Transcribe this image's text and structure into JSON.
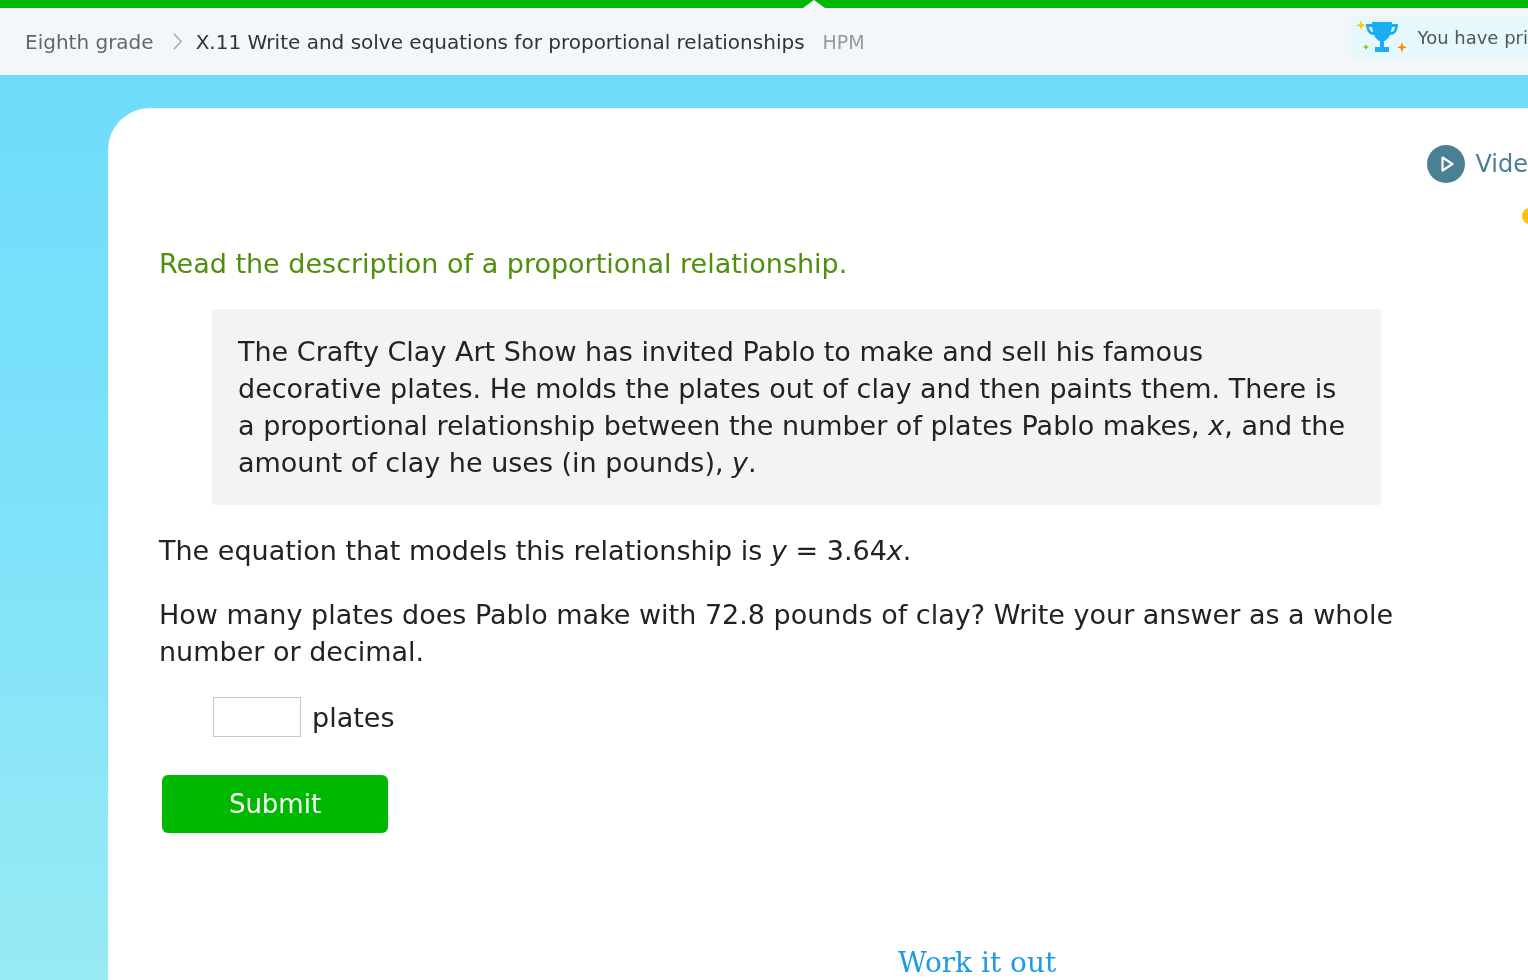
{
  "header": {
    "breadcrumb": [
      {
        "label": "Eighth grade"
      },
      {
        "label": "X.11 Write and solve equations for proportional relationships"
      }
    ],
    "code": "HPM",
    "prize_banner": "You have pri"
  },
  "video_link": "Vide",
  "instruction": "Read the description of a proportional relationship.",
  "description": "The Crafty Clay Art Show has invited Pablo to make and sell his famous decorative plates. He molds the plates out of clay and then paints them. There is a proportional relationship between the number of plates Pablo makes, *x*, and the amount of clay he uses (in pounds), *y*.",
  "equation_statement": [
    {
      "text": "The equation that models this relationship is",
      "italic": false
    },
    {
      "text": "y",
      "italic": true
    },
    {
      "text": "= 3.64",
      "italic": false
    },
    {
      "text": "x",
      "italic": true,
      "attached": true
    },
    {
      "text": ".",
      "italic": false,
      "attached": true
    }
  ],
  "question": "How many plates does Pablo make with 72.8 pounds of clay? Write your answer as a whole number or decimal.",
  "answer": {
    "unit": "plates"
  },
  "submit_button": "Submit",
  "work_it_out": "Work it out"
}
